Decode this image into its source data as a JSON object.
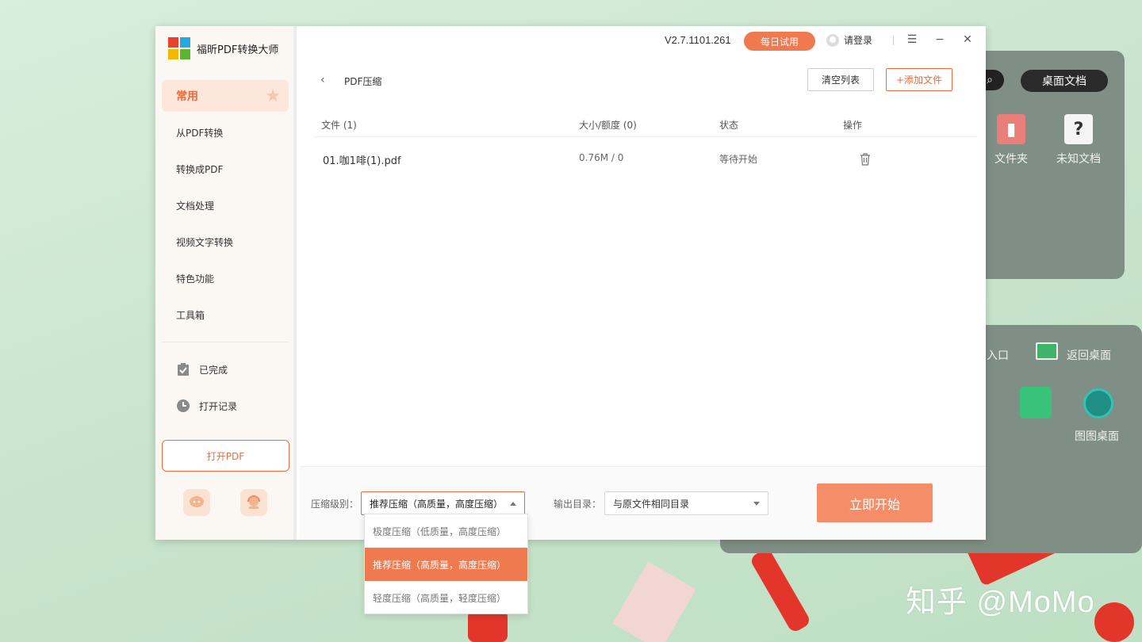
{
  "app": {
    "title": "福昕PDF转换大师",
    "version": "V2.7.1101.261",
    "trial_label": "每日试用",
    "login_label": "请登录",
    "accent": "#ee6a3c"
  },
  "sidebar": {
    "active_item": "常用",
    "items": [
      "从PDF转换",
      "转换成PDF",
      "文档处理",
      "视频文字转换",
      "特色功能",
      "工具箱"
    ],
    "completed_label": "已完成",
    "history_label": "打开记录",
    "open_pdf_label": "打开PDF"
  },
  "main": {
    "back_icon": "‹",
    "page_title": "PDF压缩",
    "clear_label": "清空列表",
    "add_label": "+添加文件",
    "columns": {
      "file": "文件 (1)",
      "size": "大小/额度 (0)",
      "status": "状态",
      "action": "操作"
    },
    "rows": [
      {
        "name": "01.咖1啡(1).pdf",
        "size": "0.76M / 0",
        "status": "等待开始"
      }
    ]
  },
  "bottom": {
    "level_label": "压缩级别：",
    "level_value": "推荐压缩（高质量，高度压缩）",
    "output_label": "输出目录：",
    "output_value": "与原文件相同目录",
    "start_label": "立即开始"
  },
  "dropdown": {
    "options": [
      "极度压缩（低质量，高度压缩）",
      "推荐压缩（高质量，高度压缩）",
      "轻度压缩（高质量，轻度压缩）"
    ],
    "selected_index": 1
  },
  "desktop": {
    "pill_label": "桌面文档",
    "folder_label": "文件夹",
    "unknown_label": "未知文档",
    "entry_label": "入口",
    "back_desktop_label": "返回桌面",
    "tutu_label": "图图桌面",
    "watermark": "知乎 @MoMo"
  }
}
